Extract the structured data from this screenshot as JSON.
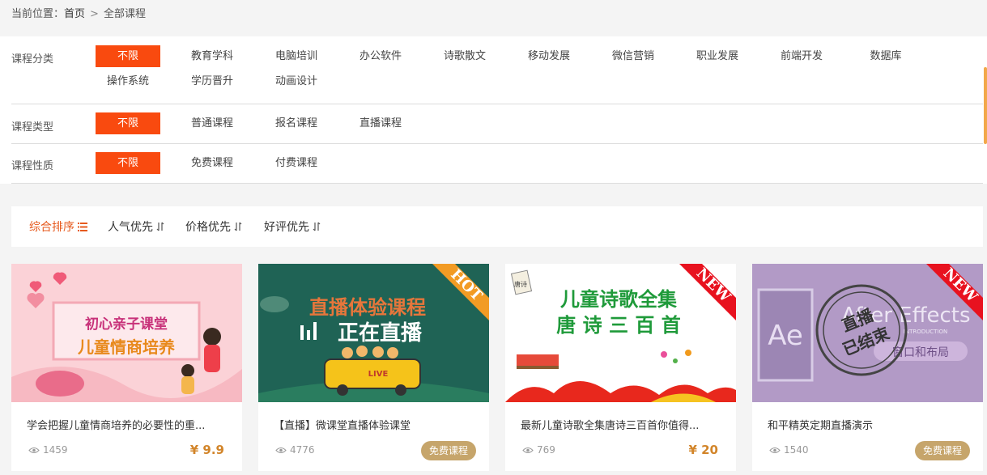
{
  "breadcrumb": {
    "prefix": "当前位置：",
    "home": "首页",
    "sep": ">",
    "current": "全部课程"
  },
  "filters": {
    "category": {
      "label": "课程分类",
      "options": [
        "不限",
        "教育学科",
        "电脑培训",
        "办公软件",
        "诗歌散文",
        "移动发展",
        "微信营销",
        "职业发展",
        "前端开发",
        "数据库",
        "操作系统",
        "学历晋升",
        "动画设计"
      ]
    },
    "type": {
      "label": "课程类型",
      "options": [
        "不限",
        "普通课程",
        "报名课程",
        "直播课程"
      ]
    },
    "nature": {
      "label": "课程性质",
      "options": [
        "不限",
        "免费课程",
        "付费课程"
      ]
    }
  },
  "sort": [
    {
      "label": "综合排序",
      "icon": "list-icon",
      "active": true
    },
    {
      "label": "人气优先",
      "icon": "sort-arrows-icon",
      "active": false
    },
    {
      "label": "价格优先",
      "icon": "sort-arrows-icon",
      "active": false
    },
    {
      "label": "好评优先",
      "icon": "sort-arrows-icon",
      "active": false
    }
  ],
  "courses": [
    {
      "title": "学会把握儿童情商培养的必要性的重...",
      "views": "1459",
      "price": "¥ 9.9",
      "thumb": {
        "line1": "初心亲子课堂",
        "line2": "儿童情商培养"
      }
    },
    {
      "title": "【直播】微课堂直播体验课堂",
      "views": "4776",
      "free_label": "免费课程",
      "ribbon": "HOT",
      "thumb": {
        "line1": "直播体验课程",
        "line2": "正在直播",
        "bus": "LIVE"
      }
    },
    {
      "title": "最新儿童诗歌全集唐诗三百首你值得...",
      "views": "769",
      "price": "¥ 20",
      "ribbon": "NEW",
      "thumb": {
        "line1": "儿童诗歌全集",
        "line2": "唐 诗 三 百 首",
        "scroll": "唐诗"
      }
    },
    {
      "title": "和平精英定期直播演示",
      "views": "1540",
      "free_label": "免费课程",
      "ribbon": "NEW",
      "thumb": {
        "ae": "Ae",
        "brand": "After Effects",
        "sub": "INTRODUCTION",
        "tag": "窗口和布局",
        "stamp1": "直播",
        "stamp2": "已结束"
      }
    }
  ],
  "colors": {
    "accent": "#f94a0f",
    "sort_active": "#e65a1e",
    "price": "#d2852a",
    "free_badge": "#c6a56b"
  }
}
